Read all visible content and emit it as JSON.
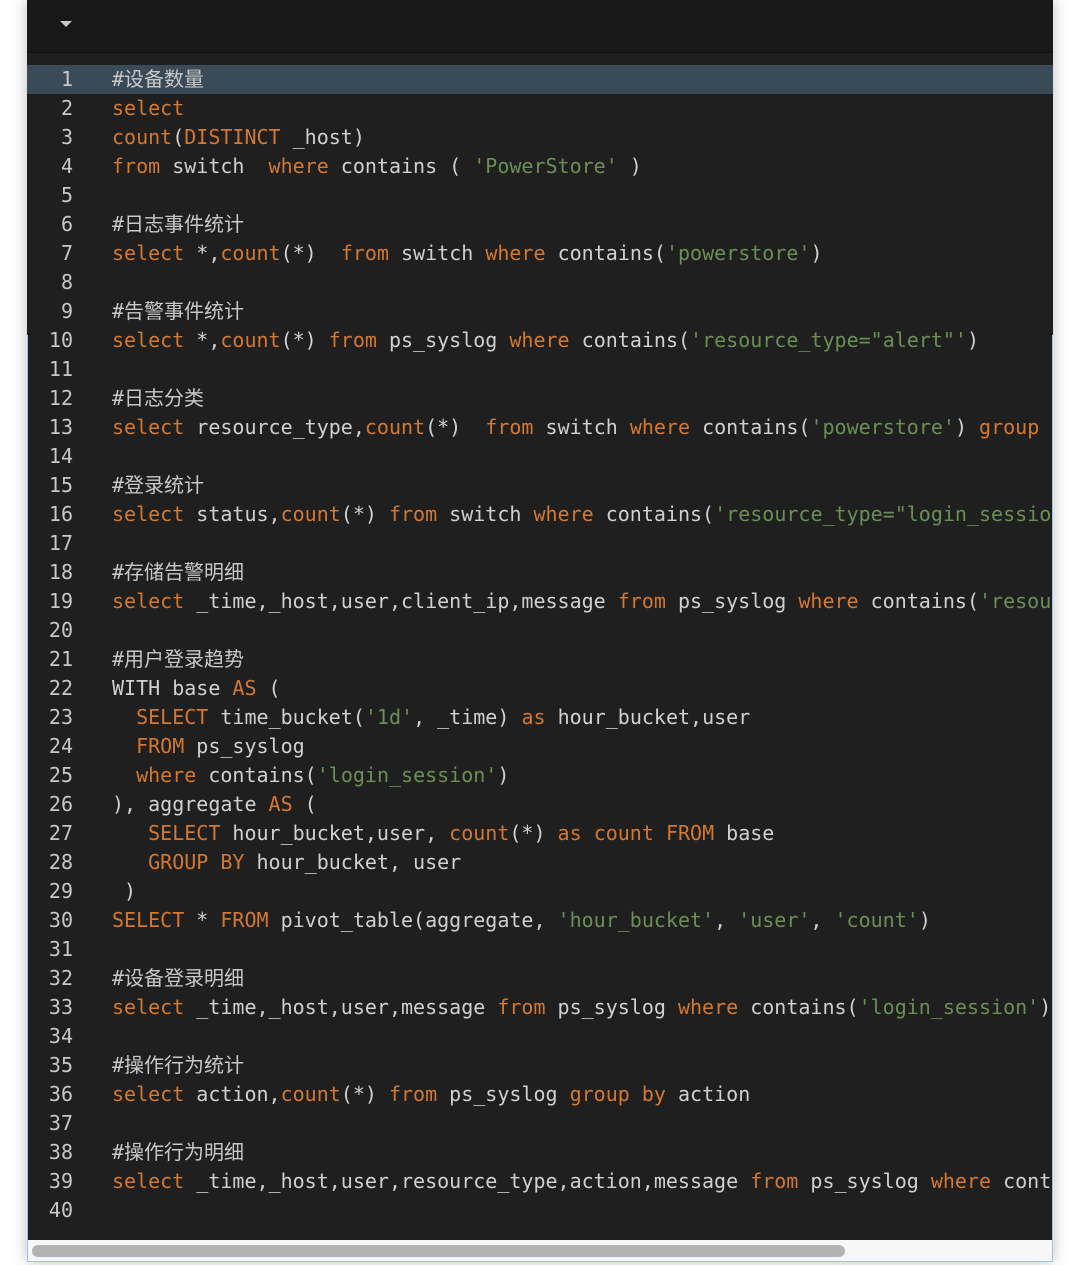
{
  "editor": {
    "active_line": 1,
    "scroll_fraction_visible": 0.8,
    "colors": {
      "keyword": "#d4782f",
      "string": "#6a8f55",
      "text": "#d0d0d0",
      "background": "#1f1f1f",
      "active_line": "#3a4a57"
    },
    "lines": [
      [
        [
          "c",
          "#设备数量"
        ]
      ],
      [
        [
          "k",
          "select"
        ]
      ],
      [
        [
          "k",
          "count"
        ],
        [
          "t",
          "("
        ],
        [
          "k",
          "DISTINCT"
        ],
        [
          "t",
          " _host)"
        ]
      ],
      [
        [
          "k",
          "from"
        ],
        [
          "t",
          " switch  "
        ],
        [
          "k",
          "where"
        ],
        [
          "t",
          " contains ( "
        ],
        [
          "s",
          "'PowerStore'"
        ],
        [
          "t",
          " )"
        ]
      ],
      [],
      [
        [
          "c",
          "#日志事件统计"
        ]
      ],
      [
        [
          "k",
          "select"
        ],
        [
          "t",
          " *,"
        ],
        [
          "k",
          "count"
        ],
        [
          "t",
          "(*)  "
        ],
        [
          "k",
          "from"
        ],
        [
          "t",
          " switch "
        ],
        [
          "k",
          "where"
        ],
        [
          "t",
          " contains("
        ],
        [
          "s",
          "'powerstore'"
        ],
        [
          "t",
          ")"
        ]
      ],
      [],
      [
        [
          "c",
          "#告警事件统计"
        ]
      ],
      [
        [
          "k",
          "select"
        ],
        [
          "t",
          " *,"
        ],
        [
          "k",
          "count"
        ],
        [
          "t",
          "(*) "
        ],
        [
          "k",
          "from"
        ],
        [
          "t",
          " ps_syslog "
        ],
        [
          "k",
          "where"
        ],
        [
          "t",
          " contains("
        ],
        [
          "s",
          "'resource_type=\"alert\"'"
        ],
        [
          "t",
          ")"
        ]
      ],
      [],
      [
        [
          "c",
          "#日志分类"
        ]
      ],
      [
        [
          "k",
          "select"
        ],
        [
          "t",
          " resource_type,"
        ],
        [
          "k",
          "count"
        ],
        [
          "t",
          "(*)  "
        ],
        [
          "k",
          "from"
        ],
        [
          "t",
          " switch "
        ],
        [
          "k",
          "where"
        ],
        [
          "t",
          " contains("
        ],
        [
          "s",
          "'powerstore'"
        ],
        [
          "t",
          ") "
        ],
        [
          "k",
          "group"
        ]
      ],
      [],
      [
        [
          "c",
          "#登录统计"
        ]
      ],
      [
        [
          "k",
          "select"
        ],
        [
          "t",
          " status,"
        ],
        [
          "k",
          "count"
        ],
        [
          "t",
          "(*) "
        ],
        [
          "k",
          "from"
        ],
        [
          "t",
          " switch "
        ],
        [
          "k",
          "where"
        ],
        [
          "t",
          " contains("
        ],
        [
          "s",
          "'resource_type=\"login_sessio"
        ]
      ],
      [],
      [
        [
          "c",
          "#存储告警明细"
        ]
      ],
      [
        [
          "k",
          "select"
        ],
        [
          "t",
          " _time,_host,user,client_ip,message "
        ],
        [
          "k",
          "from"
        ],
        [
          "t",
          " ps_syslog "
        ],
        [
          "k",
          "where"
        ],
        [
          "t",
          " contains("
        ],
        [
          "s",
          "'resou"
        ]
      ],
      [],
      [
        [
          "c",
          "#用户登录趋势"
        ]
      ],
      [
        [
          "t",
          "WITH base "
        ],
        [
          "k",
          "AS"
        ],
        [
          "t",
          " ("
        ]
      ],
      [
        [
          "t",
          "  "
        ],
        [
          "k",
          "SELECT"
        ],
        [
          "t",
          " time_bucket("
        ],
        [
          "s",
          "'1d'"
        ],
        [
          "t",
          ", _time) "
        ],
        [
          "k",
          "as"
        ],
        [
          "t",
          " hour_bucket,user"
        ]
      ],
      [
        [
          "t",
          "  "
        ],
        [
          "k",
          "FROM"
        ],
        [
          "t",
          " ps_syslog"
        ]
      ],
      [
        [
          "t",
          "  "
        ],
        [
          "k",
          "where"
        ],
        [
          "t",
          " contains("
        ],
        [
          "s",
          "'login_session'"
        ],
        [
          "t",
          ")"
        ]
      ],
      [
        [
          "t",
          "), aggregate "
        ],
        [
          "k",
          "AS"
        ],
        [
          "t",
          " ("
        ]
      ],
      [
        [
          "t",
          "   "
        ],
        [
          "k",
          "SELECT"
        ],
        [
          "t",
          " hour_bucket,user, "
        ],
        [
          "k",
          "count"
        ],
        [
          "t",
          "(*) "
        ],
        [
          "k",
          "as"
        ],
        [
          "t",
          " "
        ],
        [
          "k",
          "count"
        ],
        [
          "t",
          " "
        ],
        [
          "k",
          "FROM"
        ],
        [
          "t",
          " base"
        ]
      ],
      [
        [
          "t",
          "   "
        ],
        [
          "k",
          "GROUP BY"
        ],
        [
          "t",
          " hour_bucket, user"
        ]
      ],
      [
        [
          "t",
          " )"
        ]
      ],
      [
        [
          "k",
          "SELECT"
        ],
        [
          "t",
          " * "
        ],
        [
          "k",
          "FROM"
        ],
        [
          "t",
          " pivot_table(aggregate, "
        ],
        [
          "s",
          "'hour_bucket'"
        ],
        [
          "t",
          ", "
        ],
        [
          "s",
          "'user'"
        ],
        [
          "t",
          ", "
        ],
        [
          "s",
          "'count'"
        ],
        [
          "t",
          ")"
        ]
      ],
      [],
      [
        [
          "c",
          "#设备登录明细"
        ]
      ],
      [
        [
          "k",
          "select"
        ],
        [
          "t",
          " _time,_host,user,message "
        ],
        [
          "k",
          "from"
        ],
        [
          "t",
          " ps_syslog "
        ],
        [
          "k",
          "where"
        ],
        [
          "t",
          " contains("
        ],
        [
          "s",
          "'login_session'"
        ],
        [
          "t",
          ")"
        ]
      ],
      [],
      [
        [
          "c",
          "#操作行为统计"
        ]
      ],
      [
        [
          "k",
          "select"
        ],
        [
          "t",
          " action,"
        ],
        [
          "k",
          "count"
        ],
        [
          "t",
          "(*) "
        ],
        [
          "k",
          "from"
        ],
        [
          "t",
          " ps_syslog "
        ],
        [
          "k",
          "group"
        ],
        [
          "t",
          " "
        ],
        [
          "k",
          "by"
        ],
        [
          "t",
          " action"
        ]
      ],
      [],
      [
        [
          "c",
          "#操作行为明细"
        ]
      ],
      [
        [
          "k",
          "select"
        ],
        [
          "t",
          " _time,_host,user,resource_type,action,message "
        ],
        [
          "k",
          "from"
        ],
        [
          "t",
          " ps_syslog "
        ],
        [
          "k",
          "where"
        ],
        [
          "t",
          " cont"
        ]
      ],
      []
    ]
  }
}
